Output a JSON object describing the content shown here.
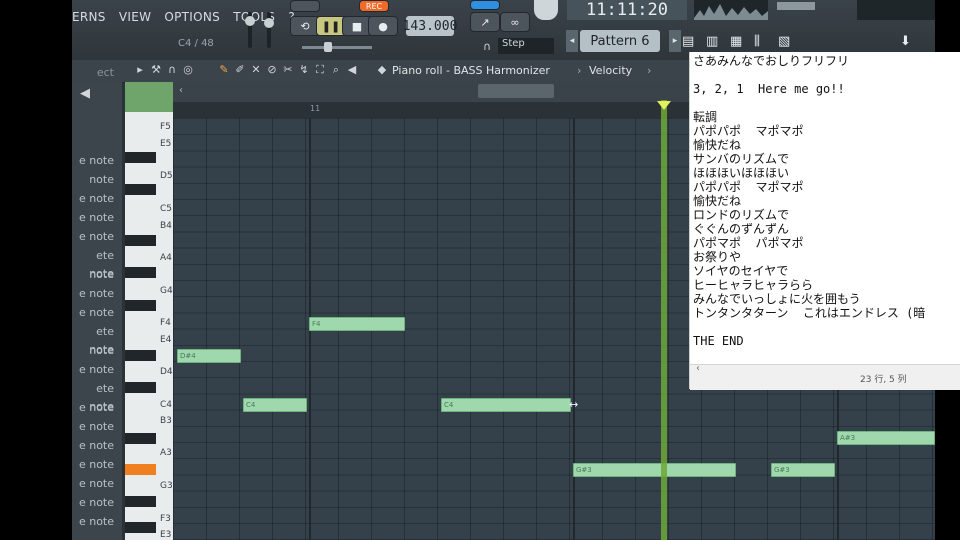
{
  "menu": [
    "ERNS",
    "VIEW",
    "OPTIONS",
    "TOOLS",
    "?"
  ],
  "hint": "C4 / 48",
  "transport": {
    "rec_label": "REC",
    "tempo": "143.000",
    "step_label": "Step",
    "clock": "11:11:20",
    "pattern": "Pattern 6"
  },
  "toolbar": {
    "title": "Piano roll - BASS Harmonizer",
    "sep": "›",
    "target": "Velocity"
  },
  "left_strip": {
    "top_label": "ect",
    "channels": [
      "e note",
      "note",
      "e note",
      "e note",
      "e note",
      "ete note",
      "note",
      "e note",
      "e note",
      "ete note",
      "note",
      "e note",
      "ete note",
      "e note",
      "e note",
      "e note",
      "e note",
      "e note",
      "e note",
      "e note",
      "e note",
      "e note"
    ]
  },
  "keys": [
    "F5",
    "E5",
    "D5",
    "C5",
    "B4",
    "A4",
    "G4",
    "F4",
    "E4",
    "D4",
    "C4",
    "B3",
    "A3",
    "G3",
    "F3",
    "E3"
  ],
  "timeline_marker": "11",
  "notes": [
    {
      "pitch": "D#4",
      "label": "D#4"
    },
    {
      "pitch": "F4",
      "label": "F4"
    },
    {
      "pitch": "C4",
      "label": "C4"
    },
    {
      "pitch": "C4",
      "label": "C4"
    },
    {
      "pitch": "G#3",
      "label": "G#3"
    },
    {
      "pitch": "G#3",
      "label": "G#3"
    },
    {
      "pitch": "A#3",
      "label": "A#3"
    }
  ],
  "notepad": {
    "lyrics": "さあみんなでおしりフリフリ\n\n3, 2, 1  Here me go!!\n\n転調\nパポパポ  マポマポ\n愉快だね\nサンバのリズムで\nほほほいほほほい\nパポパポ  マポマポ\n愉快だね\nロンドのリズムで\nぐぐんのずんずん\nパポマポ  パポマポ\nお祭りや\nソイヤのセイヤで\nヒーヒャラヒャラらら\nみんなでいっしょに火を囲もう\nトンタンタターン  これはエンドレス (暗\n\nTHE END",
    "status": "23 行, 5 列"
  }
}
